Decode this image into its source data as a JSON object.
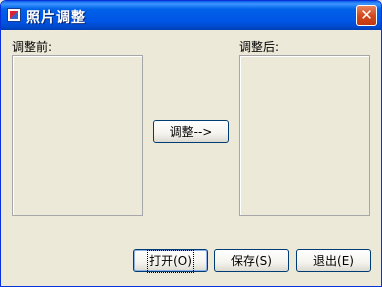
{
  "window": {
    "title": "照片调整"
  },
  "labels": {
    "before": "调整前:",
    "after": "调整后:"
  },
  "buttons": {
    "adjust": "调整-->",
    "open": "打开(O)",
    "save": "保存(S)",
    "exit": "退出(E)"
  },
  "icons": {
    "app": "app-icon",
    "close": "close-icon"
  },
  "colors": {
    "titlebar": "#0055e5",
    "close": "#d44a1f",
    "face": "#ece9d8",
    "button_border": "#003c74"
  }
}
